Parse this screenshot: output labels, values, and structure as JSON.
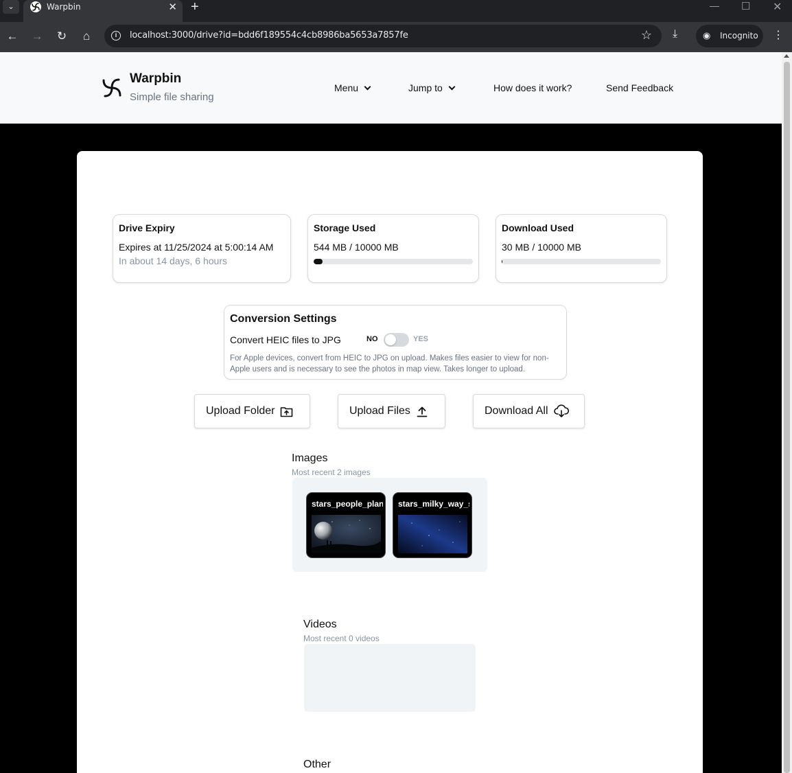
{
  "browser": {
    "tab_title": "Warpbin",
    "url": "localhost:3000/drive?id=bdd6f189554c4cb8986ba5653a7857fe",
    "incognito_label": "Incognito"
  },
  "header": {
    "brand": "Warpbin",
    "tagline": "Simple file sharing",
    "nav": {
      "menu": "Menu",
      "jump_to": "Jump to",
      "how": "How does it work?",
      "feedback": "Send Feedback"
    }
  },
  "stats": {
    "expiry": {
      "title": "Drive Expiry",
      "value": "Expires at 11/25/2024 at 5:00:14 AM",
      "relative": "In about 14 days, 6 hours"
    },
    "storage": {
      "title": "Storage Used",
      "value": "544 MB / 10000 MB",
      "fraction": 0.0544
    },
    "download": {
      "title": "Download Used",
      "value": "30 MB / 10000 MB",
      "fraction": 0.003
    }
  },
  "conversion": {
    "title": "Conversion Settings",
    "label": "Convert HEIC files to JPG",
    "no": "NO",
    "yes": "YES",
    "enabled": false,
    "description": "For Apple devices, convert from HEIC to JPG on upload. Makes files easier to view for non-Apple users and is necessary to see the photos in map view. Takes longer to upload."
  },
  "actions": {
    "upload_folder": "Upload Folder",
    "upload_files": "Upload Files",
    "download_all": "Download All"
  },
  "images": {
    "title": "Images",
    "subtitle": "Most recent 2 images",
    "items": [
      {
        "name": "stars_people_planet"
      },
      {
        "name": "stars_milky_way_sky"
      }
    ]
  },
  "videos": {
    "title": "Videos",
    "subtitle": "Most recent 0 videos"
  },
  "other": {
    "title": "Other"
  }
}
